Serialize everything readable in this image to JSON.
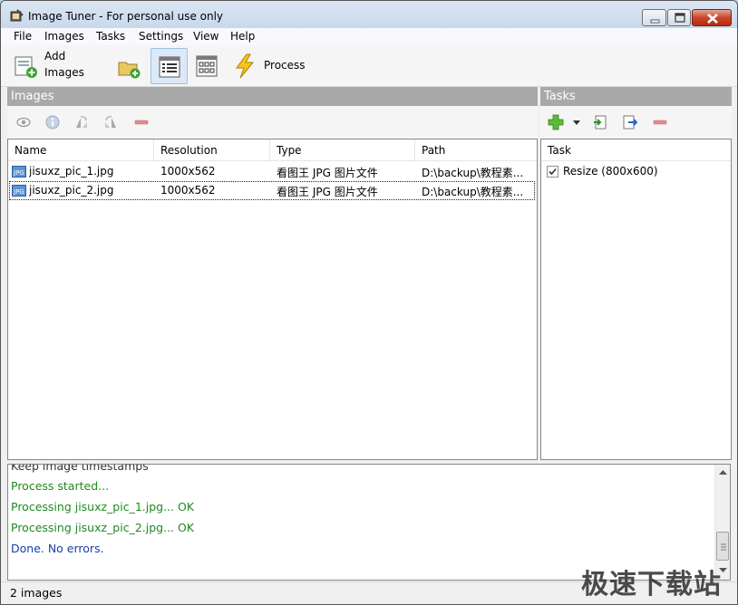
{
  "window": {
    "title": "Image Tuner - For personal use only"
  },
  "menu": [
    "File",
    "Images",
    "Tasks",
    "Settings",
    "View",
    "Help"
  ],
  "toolbar": {
    "add_images_line1": "Add",
    "add_images_line2": "Images",
    "process_label": "Process",
    "icons": [
      "add-images-icon",
      "add-folder-icon",
      "details-view-icon",
      "thumbnails-view-icon",
      "process-lightning-icon"
    ]
  },
  "images_panel": {
    "title": "Images",
    "columns": [
      "Name",
      "Resolution",
      "Type",
      "Path"
    ],
    "rows": [
      {
        "name": "jisuxz_pic_1.jpg",
        "resolution": "1000x562",
        "type": "看图王 JPG 图片文件",
        "path": "D:\\backup\\教程素..."
      },
      {
        "name": "jisuxz_pic_2.jpg",
        "resolution": "1000x562",
        "type": "看图王 JPG 图片文件",
        "path": "D:\\backup\\教程素..."
      }
    ]
  },
  "tasks_panel": {
    "title": "Tasks",
    "column": "Task",
    "items": [
      {
        "label": "Resize (800x600)",
        "checked": true
      }
    ]
  },
  "log": {
    "partial_line": "Keep image timestamps",
    "lines": [
      {
        "text": "Process started...",
        "color": "#1e8a1e"
      },
      {
        "text": "Processing jisuxz_pic_1.jpg... OK",
        "color": "#1e8a1e"
      },
      {
        "text": "Processing jisuxz_pic_2.jpg... OK",
        "color": "#1e8a1e"
      },
      {
        "text": "Done. No errors.",
        "color": "#1a3fa8"
      }
    ]
  },
  "status": {
    "text": "2 images"
  },
  "watermark": "极速下载站"
}
